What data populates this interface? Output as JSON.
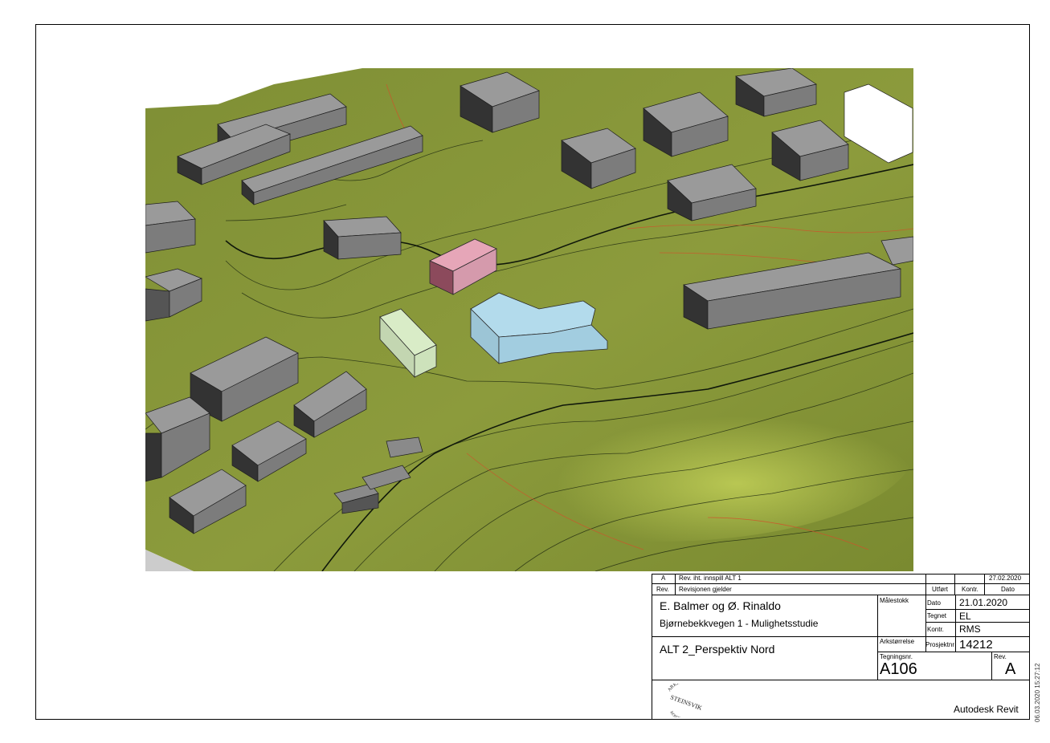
{
  "title_block": {
    "rev_row": {
      "rev": "A",
      "description": "Rev. iht. innspill ALT 1",
      "date": "27.02.2020"
    },
    "header_row": {
      "rev_label": "Rev.",
      "description_label": "Revisjonen gjelder",
      "utfort_label": "Utført",
      "kontr_label": "Kontr.",
      "dato_label": "Dato"
    },
    "client": "E. Balmer og Ø. Rinaldo",
    "project": "Bjørnebekkvegen 1 - Mulighetsstudie",
    "scale_label": "Målestokk",
    "dato_label": "Dato",
    "dato_value": "21.01.2020",
    "tegnet_label": "Tegnet",
    "tegnet_value": "EL",
    "kontr_label": "Kontr.",
    "kontr_value": "RMS",
    "sheet_title": "ALT 2_Perspektiv Nord",
    "arkstorrelse_label": "Arkstørrelse",
    "prosjektnr_label": "Prosjektnr",
    "prosjektnr_value": "14212",
    "tegningsnr_label": "Tegningsnr.",
    "tegningsnr_value": "A106",
    "rev_label": "Rev.",
    "rev_value": "A",
    "software": "Autodesk Revit",
    "logo_text_top": "ARKITEKT",
    "logo_text_mid": "STEINSVIK",
    "logo_text_bottom": "KONTOR AS"
  },
  "print_stamp": "06.03.2020 15:27:12",
  "colors": {
    "terrain": "#8a9a3a",
    "terrain_light": "#b4c24c",
    "building_grey": "#8c8c8c",
    "building_dark": "#2e2e2e",
    "pink": "#e0a0b4",
    "green": "#d4e8c0",
    "blue": "#a8d4e6"
  }
}
